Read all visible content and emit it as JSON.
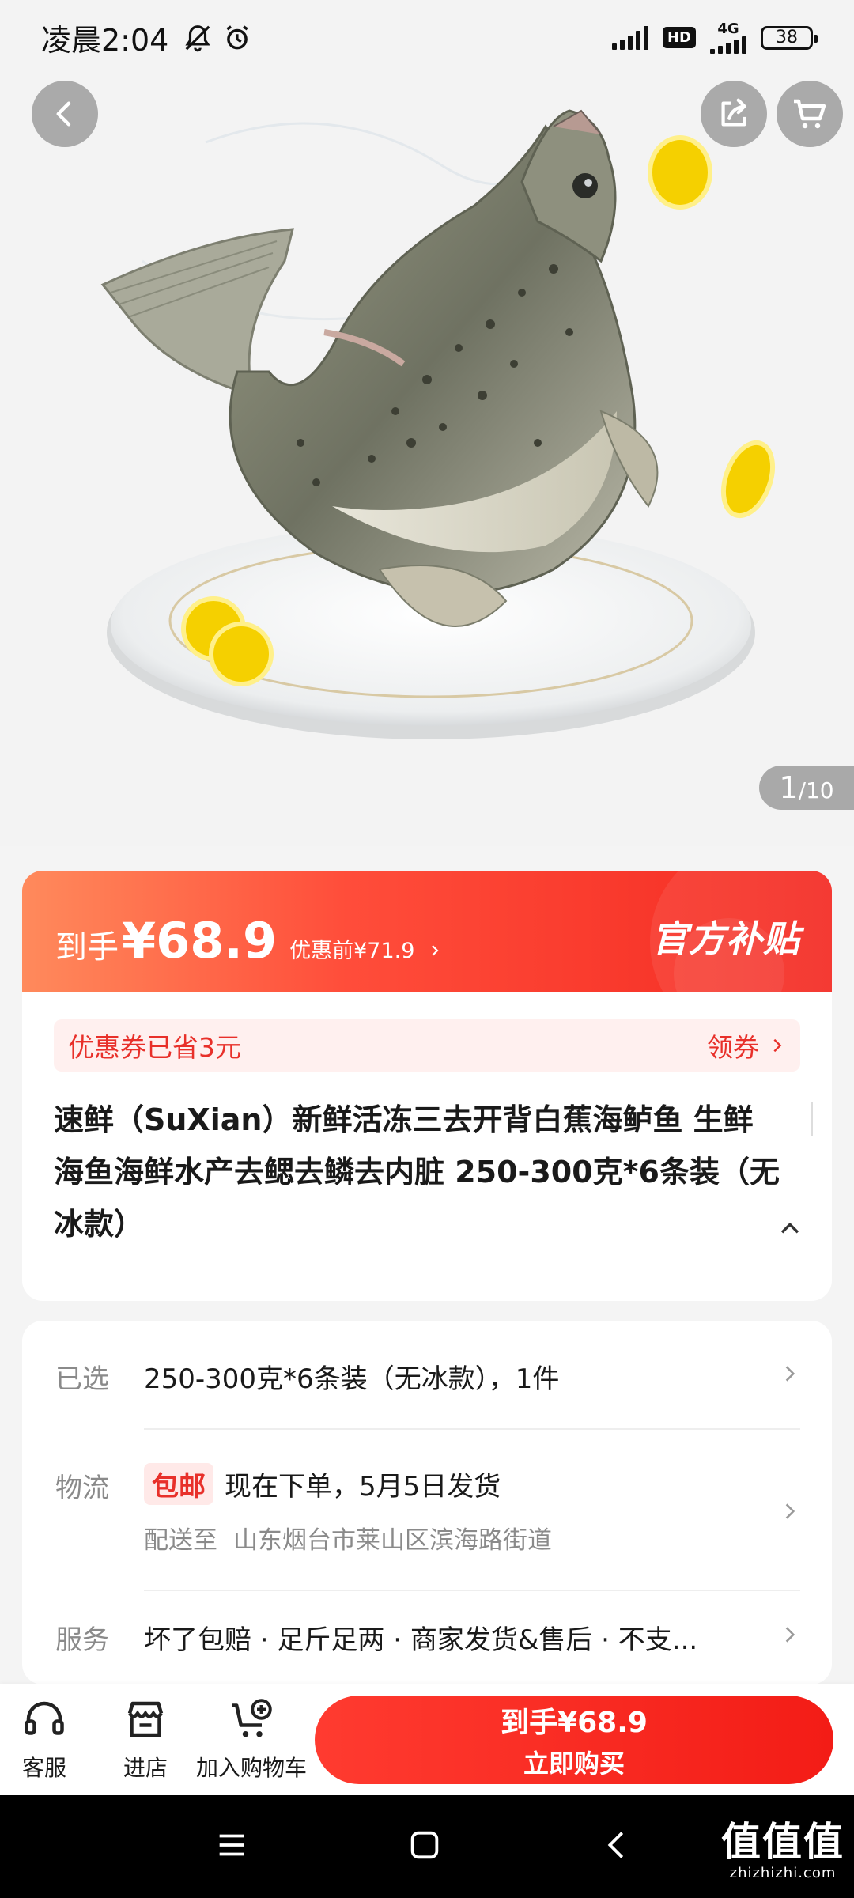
{
  "status_bar": {
    "time": "凌晨2:04",
    "hd": "HD",
    "network": "4G",
    "battery": "38"
  },
  "gallery": {
    "current": "1",
    "total": "/10"
  },
  "price_banner": {
    "label": "到手",
    "price": "¥68.9",
    "previous": "优惠前¥71.9",
    "official_tag": "官方补贴"
  },
  "coupon": {
    "saved_text": "优惠券已省3元",
    "get_label": "领券"
  },
  "product": {
    "title": "速鲜（SuXian）新鲜活冻三去开背白蕉海鲈鱼 生鲜海鱼海鲜水产去鳃去鳞去内脏 250-300克*6条装（无冰款）"
  },
  "specs": {
    "selected_label": "已选",
    "selected_value": "250-300克*6条装（无冰款），1件",
    "logistics_label": "物流",
    "free_shipping": "包邮",
    "ship_text": "现在下单，5月5日发货",
    "deliver_to_label": "配送至",
    "address": "山东烟台市莱山区滨海路街道",
    "service_label": "服务",
    "service_value": "坏了包赔 · 足斤足两 · 商家发货&售后 · 不支..."
  },
  "action_bar": {
    "customer_service": "客服",
    "store": "进店",
    "add_to_cart": "加入购物车",
    "buy_price": "到手¥68.9",
    "buy_now": "立即购买"
  },
  "watermark": {
    "brand": "值值值",
    "site": "zhizhizhi.com"
  },
  "colors": {
    "accent": "#f42a22",
    "banner_start": "#ff8a5c",
    "coupon_text": "#e8302a",
    "coupon_bg": "#fff0ef"
  }
}
